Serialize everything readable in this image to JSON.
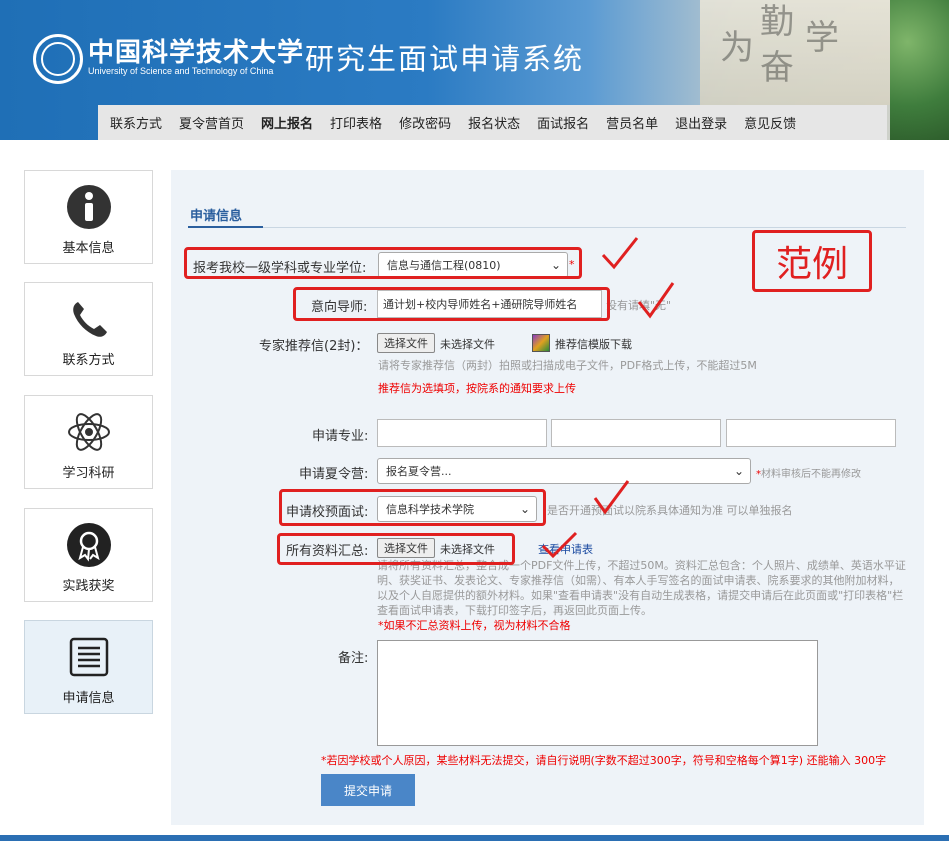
{
  "header": {
    "school_cn": "中国科学技术大学",
    "school_en": "University of Science and Technology of China",
    "system_title": "研究生面试申请系统"
  },
  "nav": [
    {
      "label": "联系方式"
    },
    {
      "label": "夏令营首页"
    },
    {
      "label": "网上报名"
    },
    {
      "label": "打印表格"
    },
    {
      "label": "修改密码"
    },
    {
      "label": "报名状态"
    },
    {
      "label": "面试报名"
    },
    {
      "label": "营员名单"
    },
    {
      "label": "退出登录"
    },
    {
      "label": "意见反馈"
    }
  ],
  "sidebar": [
    {
      "label": "基本信息",
      "icon": "info-icon"
    },
    {
      "label": "联系方式",
      "icon": "phone-icon"
    },
    {
      "label": "学习科研",
      "icon": "atom-icon"
    },
    {
      "label": "实践获奖",
      "icon": "award-icon"
    },
    {
      "label": "申请信息",
      "icon": "document-icon"
    }
  ],
  "form": {
    "tab": "申请信息",
    "discipline_label": "报考我校一级学科或专业学位:",
    "discipline_value": "信息与通信工程(0810)",
    "required_mark": "*",
    "advisor_label": "意向导师:",
    "advisor_value": "通计划+校内导师姓名+通研院导师姓名",
    "advisor_hint": "没有请填\"无\"",
    "recommend_label": "专家推荐信(2封)：",
    "choose_file": "选择文件",
    "no_file": "未选择文件",
    "template_download": "推荐信模版下载",
    "recommend_hint": "请将专家推荐信（两封）拍照或扫描成电子文件，PDF格式上传，不能超过5M",
    "recommend_note": "推荐信为选填项，按院系的通知要求上传",
    "major_label": "申请专业:",
    "camp_label": "申请夏令营:",
    "camp_value": "报名夏令营...",
    "camp_note": "材料审核后不能再修改",
    "pre_interview_label": "申请校预面试:",
    "pre_interview_value": "信息科学技术学院",
    "pre_interview_hint": "是否开通预面试以院系具体通知为准 可以单独报名",
    "all_docs_label": "所有资料汇总:",
    "view_form_link": "查看申请表",
    "all_docs_hint": "请将所有资料汇总，整合成一个PDF文件上传，不超过50M。资料汇总包含：个人照片、成绩单、英语水平证明、获奖证书、发表论文、专家推荐信（如需）、有本人手写签名的面试申请表、院系要求的其他附加材料，以及个人自愿提供的额外材料。如果\"查看申请表\"没有自动生成表格，请提交申请后在此页面或\"打印表格\"栏查看面试申请表，下载打印签字后，再返回此页面上传。",
    "all_docs_note": "*如果不汇总资料上传，视为材料不合格",
    "remark_label": "备注:",
    "remark_note": "*若因学校或个人原因，某些材料无法提交，请自行说明(字数不超过300字，符号和空格每个算1字) 还能输入 300字",
    "submit": "提交申请"
  },
  "annotation": {
    "example_label": "范例"
  }
}
